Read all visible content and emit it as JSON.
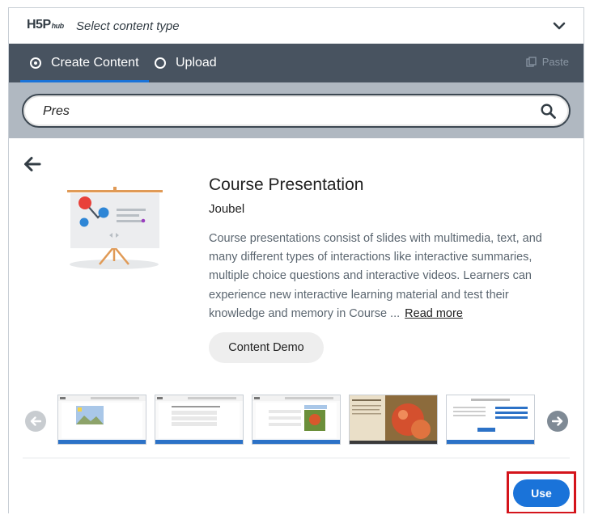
{
  "header": {
    "logo_main": "H5P",
    "logo_sub": "hub",
    "title": "Select content type"
  },
  "tabs": [
    {
      "label": "Create Content",
      "selected": true
    },
    {
      "label": "Upload",
      "selected": false
    }
  ],
  "paste_label": "Paste",
  "search": {
    "value": "Pres"
  },
  "detail": {
    "title": "Course Presentation",
    "owner": "Joubel",
    "description": "Course presentations consist of slides with multimedia, text, and many different types of interactions like interactive summaries, multiple choice questions and interactive videos. Learners can experience new interactive learning material and test their knowledge and memory in Course ...",
    "read_more": "Read more",
    "demo_label": "Content Demo"
  },
  "carousel": {
    "screenshot_count": 5
  },
  "actions": {
    "use_label": "Use"
  },
  "colors": {
    "accent": "#1a73d9",
    "tabbar": "#485360",
    "search_band": "#b0b8c1",
    "highlight": "#d4141b"
  }
}
